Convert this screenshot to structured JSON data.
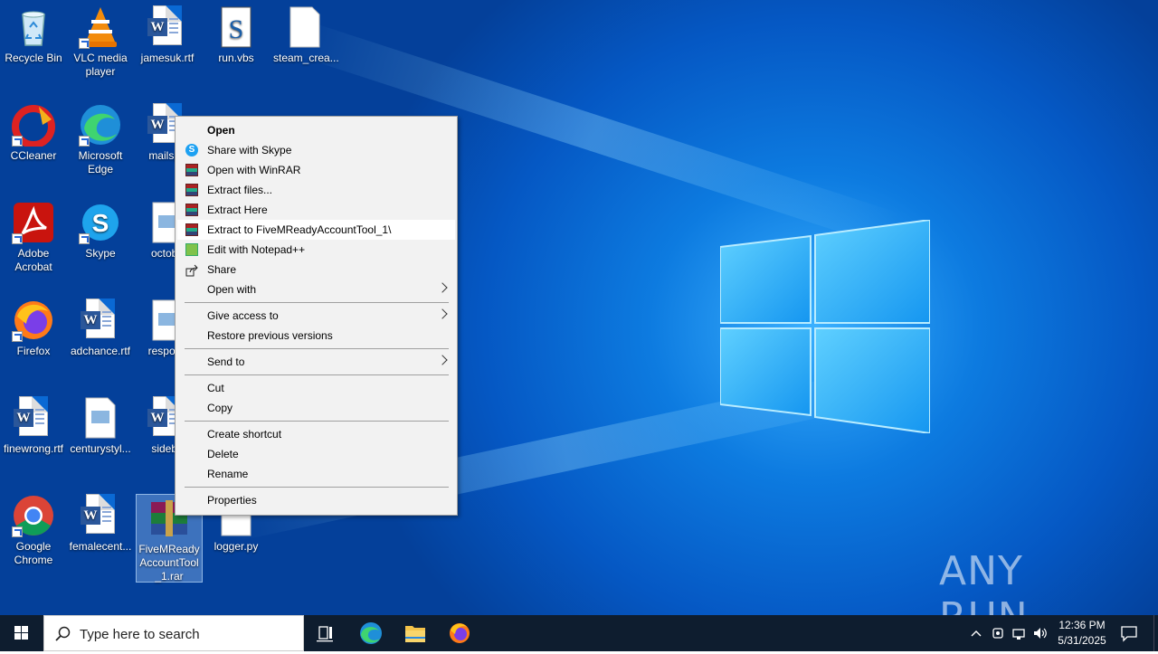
{
  "desktop_icons": [
    {
      "label": "Recycle Bin",
      "icon": "recycle-bin-icon"
    },
    {
      "label": "VLC media player",
      "icon": "vlc-icon"
    },
    {
      "label": "jamesuk.rtf",
      "icon": "word-doc-icon"
    },
    {
      "label": "run.vbs",
      "icon": "vbs-script-icon"
    },
    {
      "label": "steam_crea...",
      "icon": "blank-file-icon"
    },
    {
      "label": "CCleaner",
      "icon": "ccleaner-icon"
    },
    {
      "label": "Microsoft Edge",
      "icon": "edge-icon"
    },
    {
      "label": "mailspe",
      "icon": "word-doc-icon"
    },
    {
      "label": "Adobe Acrobat",
      "icon": "acrobat-icon"
    },
    {
      "label": "Skype",
      "icon": "skype-icon"
    },
    {
      "label": "octobe",
      "icon": "image-file-icon"
    },
    {
      "label": "Firefox",
      "icon": "firefox-icon"
    },
    {
      "label": "adchance.rtf",
      "icon": "word-doc-icon"
    },
    {
      "label": "respons",
      "icon": "image-file-icon"
    },
    {
      "label": "finewrong.rtf",
      "icon": "word-doc-icon"
    },
    {
      "label": "centurystyl...",
      "icon": "image-file-icon"
    },
    {
      "label": "sidebe",
      "icon": "word-doc-icon"
    },
    {
      "label": "Google Chrome",
      "icon": "chrome-icon"
    },
    {
      "label": "femalecent...",
      "icon": "word-doc-icon"
    },
    {
      "label": "FiveMReady AccountTool _1.rar",
      "icon": "winrar-archive-icon"
    },
    {
      "label": "logger.py",
      "icon": "blank-file-icon"
    }
  ],
  "context_menu": {
    "items": [
      {
        "label": "Open",
        "bold": true
      },
      {
        "label": "Share with Skype",
        "icon": "skype-icon"
      },
      {
        "label": "Open with WinRAR",
        "icon": "winrar-icon"
      },
      {
        "label": "Extract files...",
        "icon": "winrar-icon"
      },
      {
        "label": "Extract Here",
        "icon": "winrar-icon"
      },
      {
        "label": "Extract to FiveMReadyAccountTool_1\\",
        "icon": "winrar-icon",
        "highlighted": true
      },
      {
        "label": "Edit with Notepad++",
        "icon": "notepadpp-icon"
      },
      {
        "label": "Share",
        "icon": "share-icon"
      },
      {
        "label": "Open with",
        "submenu": true
      },
      {
        "label": "Give access to",
        "submenu": true
      },
      {
        "label": "Restore previous versions"
      },
      {
        "label": "Send to",
        "submenu": true
      },
      {
        "label": "Cut"
      },
      {
        "label": "Copy"
      },
      {
        "label": "Create shortcut"
      },
      {
        "label": "Delete"
      },
      {
        "label": "Rename"
      },
      {
        "label": "Properties"
      }
    ]
  },
  "taskbar": {
    "search_placeholder": "Type here to search",
    "pinned": [
      "task-view-icon",
      "edge-icon",
      "file-explorer-icon",
      "firefox-icon"
    ],
    "time": "12:36 PM",
    "date": "5/31/2025"
  },
  "watermark": "ANY RUN"
}
